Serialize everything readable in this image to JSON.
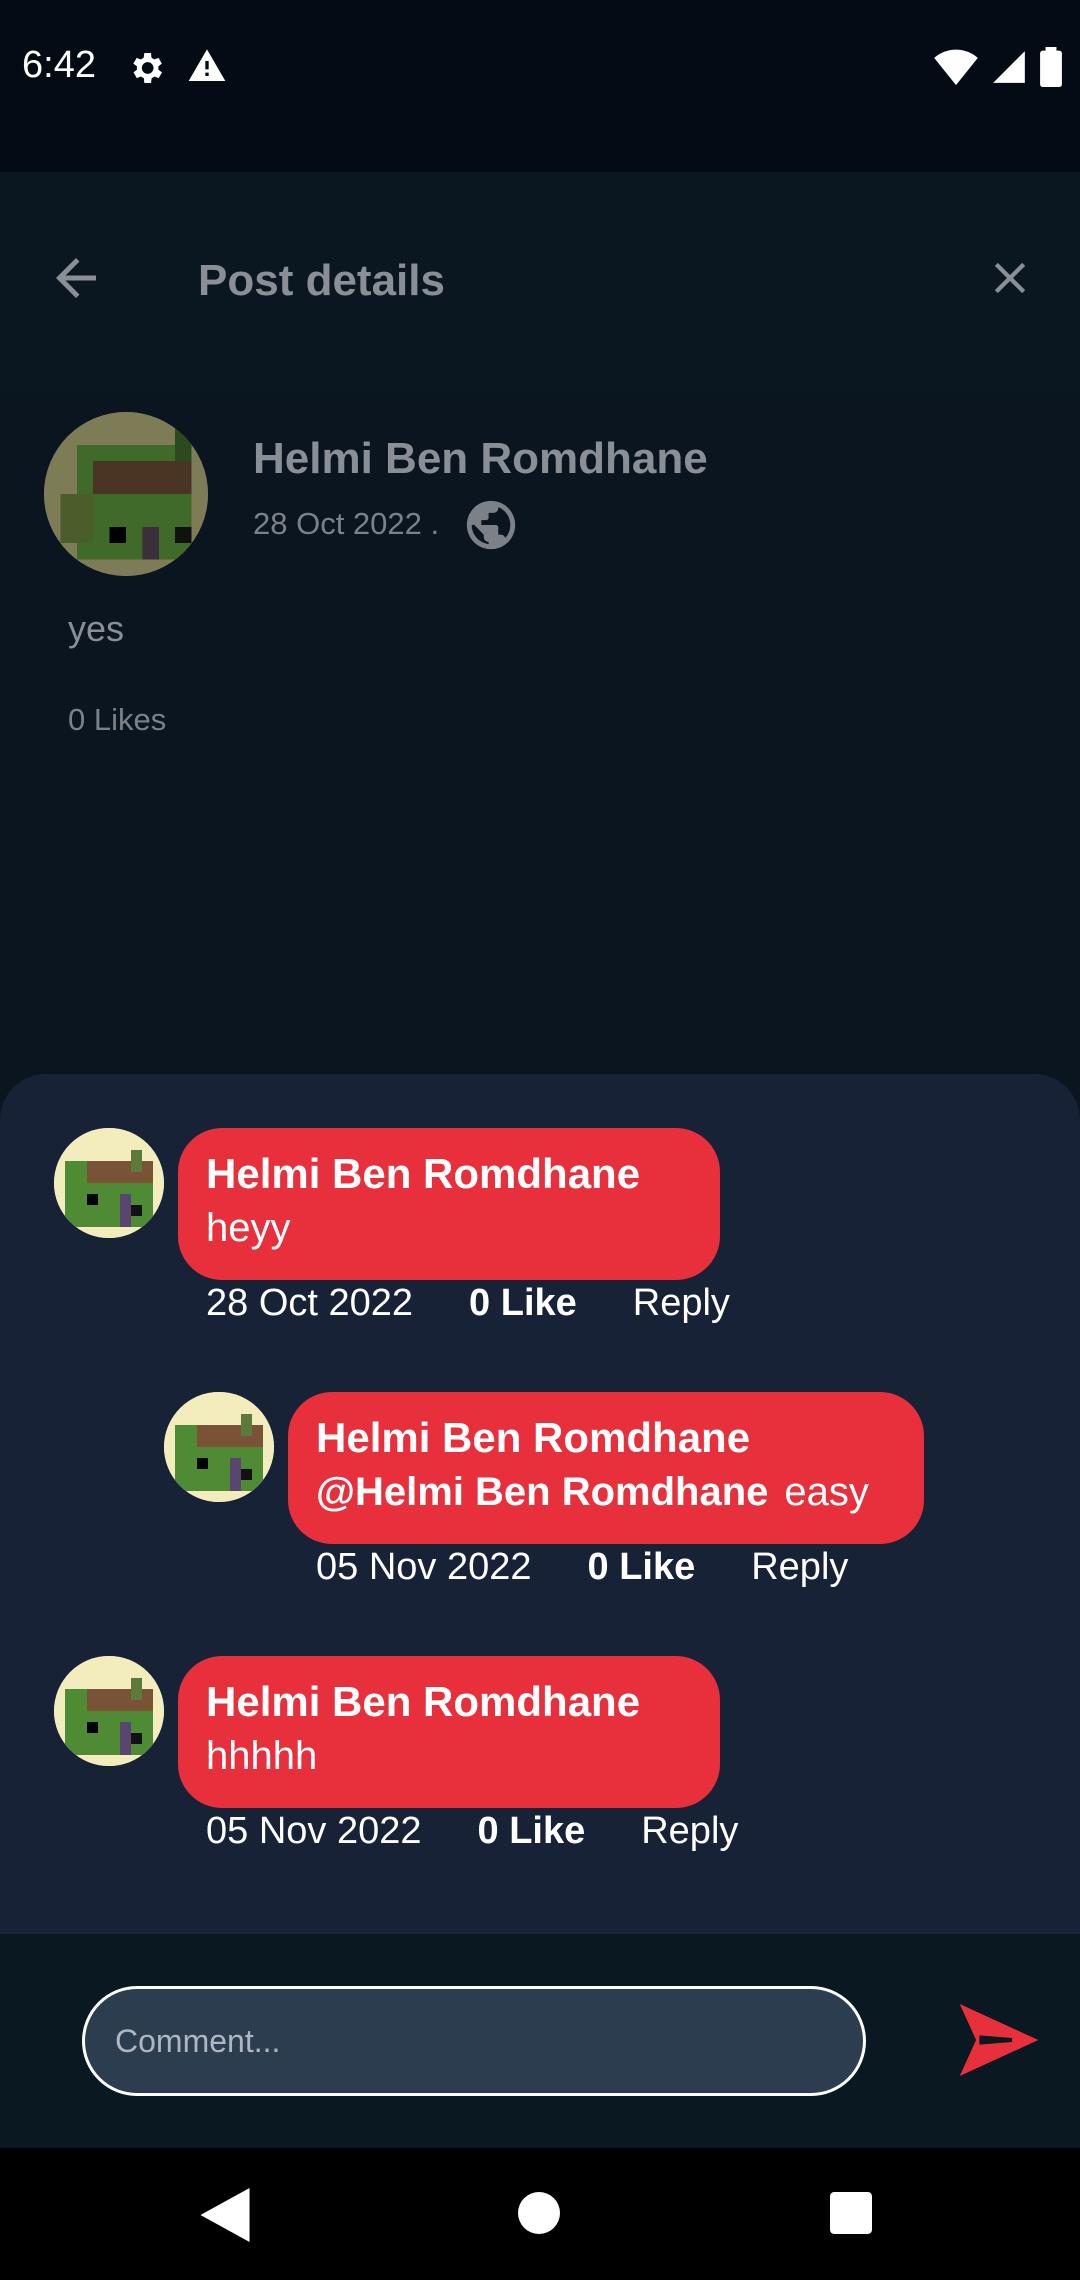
{
  "status_bar": {
    "time": "6:42",
    "icons": [
      "settings-icon",
      "alert-icon",
      "wifi-icon",
      "signal-icon",
      "battery-icon"
    ]
  },
  "app_bar": {
    "title": "Post details",
    "back_icon": "arrow-back-icon",
    "close_icon": "close-icon"
  },
  "post": {
    "author": "Helmi Ben Romdhane",
    "date": "28 Oct 2022 .",
    "visibility_icon": "globe-icon",
    "text": "yes",
    "likes": "0 Likes"
  },
  "comments": [
    {
      "name": "Helmi Ben Romdhane",
      "mention": "",
      "text": "heyy",
      "date": "28 Oct 2022",
      "like": "0 Like",
      "reply": "Reply",
      "is_reply": false
    },
    {
      "name": "Helmi Ben Romdhane",
      "mention": "@Helmi Ben Romdhane",
      "text": "easy",
      "date": "05 Nov 2022",
      "like": "0 Like",
      "reply": "Reply",
      "is_reply": true
    },
    {
      "name": "Helmi Ben Romdhane",
      "mention": "",
      "text": "hhhhh",
      "date": "05 Nov 2022",
      "like": "0 Like",
      "reply": "Reply",
      "is_reply": false
    }
  ],
  "composer": {
    "placeholder": "Comment...",
    "send_icon": "send-icon"
  },
  "nav_bar": {
    "icons": [
      "nav-back-icon",
      "nav-home-icon",
      "nav-recents-icon"
    ]
  },
  "colors": {
    "accent": "#e8303d",
    "sheet": "#172236",
    "background": "#0b1520",
    "input": "#2c3d50"
  }
}
